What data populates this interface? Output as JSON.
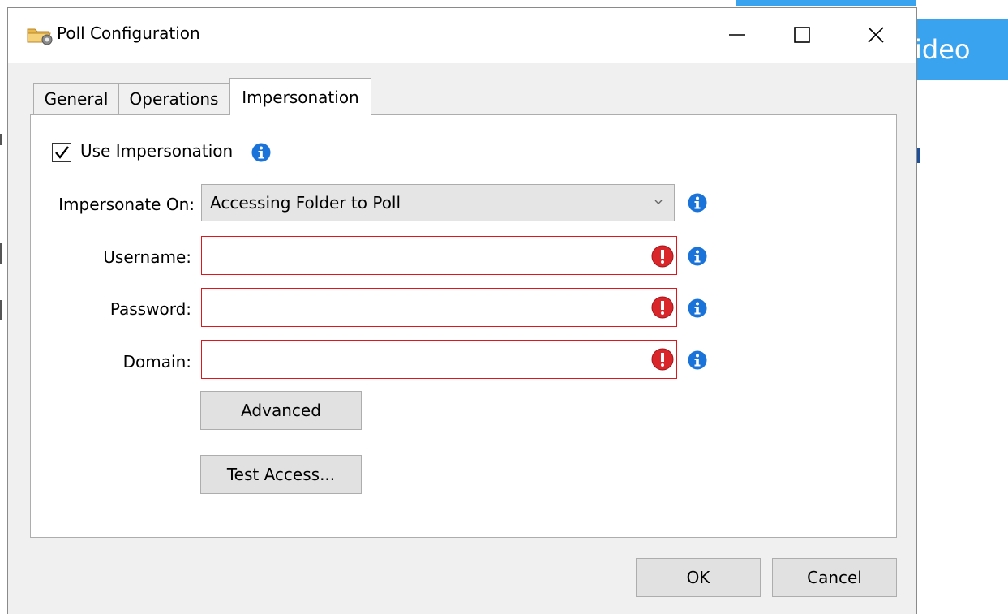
{
  "window": {
    "title": "Poll Configuration"
  },
  "background": {
    "button_label": "ideo"
  },
  "tabs": [
    {
      "label": "General"
    },
    {
      "label": "Operations"
    },
    {
      "label": "Impersonation"
    }
  ],
  "impersonation": {
    "use_impersonation_label": "Use Impersonation",
    "use_impersonation_checked": true,
    "impersonate_on_label": "Impersonate On:",
    "impersonate_on_value": "Accessing Folder to Poll",
    "username_label": "Username:",
    "username_value": "",
    "password_label": "Password:",
    "password_value": "",
    "domain_label": "Domain:",
    "domain_value": "",
    "advanced_button": "Advanced",
    "test_access_button": "Test Access..."
  },
  "footer": {
    "ok_label": "OK",
    "cancel_label": "Cancel"
  },
  "colors": {
    "error_border": "#e0161c",
    "info_blue": "#1a73d9",
    "error_red": "#d9262b",
    "background_accent": "#3aa3f0"
  },
  "icons": [
    "folder-gear-icon",
    "minimize-icon",
    "maximize-icon",
    "close-icon",
    "checkmark-icon",
    "info-icon",
    "error-icon",
    "chevron-down-icon"
  ]
}
